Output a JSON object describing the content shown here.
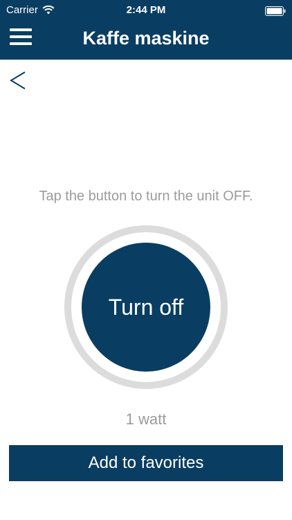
{
  "status_bar": {
    "carrier": "Carrier",
    "time": "2:44 PM",
    "wifi_icon": "wifi-icon",
    "battery_icon": "battery-icon"
  },
  "header": {
    "title": "Kaffe maskine",
    "menu_icon": "hamburger-menu-icon"
  },
  "navigation": {
    "back_icon": "chevron-left-icon"
  },
  "control": {
    "instruction": "Tap the button to turn the unit OFF.",
    "button_label": "Turn off",
    "power_reading": "1 watt"
  },
  "actions": {
    "favorites_label": "Add to favorites"
  },
  "colors": {
    "primary": "#0a3d62",
    "ring": "#dcdcdc",
    "secondary_text": "#9b9b9b",
    "background": "#ffffff"
  }
}
